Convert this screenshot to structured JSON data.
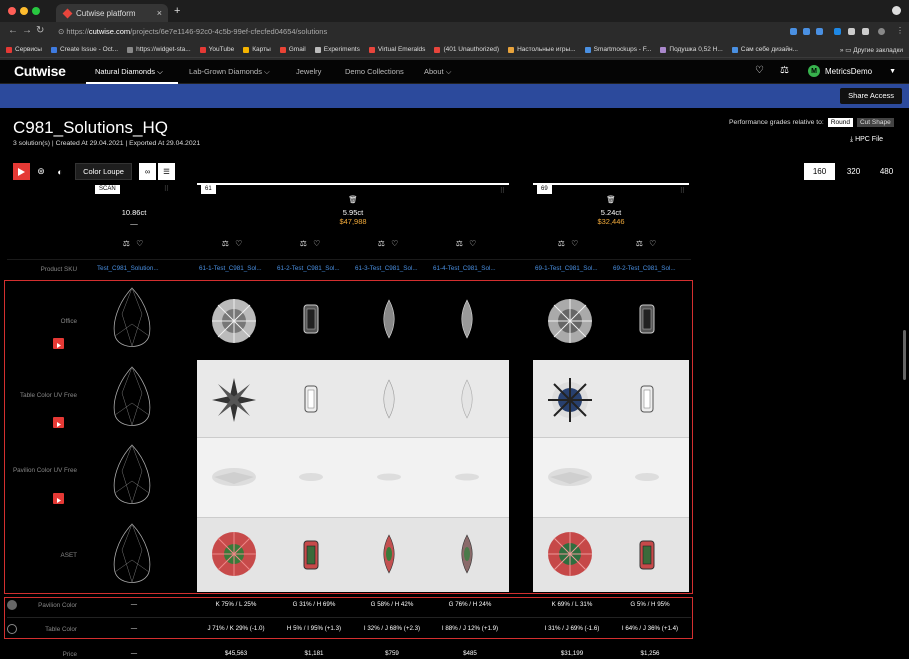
{
  "browser": {
    "tab_title": "Cutwise platform",
    "url_prefix": "https://",
    "url_domain": "cutwise.com",
    "url_path": "/projects/6e7e1146-92c0-4c5b-99ef-cfecfed04654/solutions",
    "bookmarks": [
      {
        "label": "Сервисы",
        "color": "#3f7be0"
      },
      {
        "label": "Create Issue - Oct...",
        "color": "#3f7be0"
      },
      {
        "label": "https://widget-sta...",
        "color": "#888"
      },
      {
        "label": "YouTube",
        "color": "#e53935"
      },
      {
        "label": "Карты",
        "color": "#f5b400"
      },
      {
        "label": "Gmail",
        "color": "#ea4335"
      },
      {
        "label": "Experiments",
        "color": "#bbb"
      },
      {
        "label": "Virtual Emeralds",
        "color": "#e8453c"
      },
      {
        "label": "(401 Unauthorized)",
        "color": "#e8453c"
      },
      {
        "label": "Настольные игры...",
        "color": "#e8a33c"
      },
      {
        "label": "Smartmockups - F...",
        "color": "#4a90e2"
      },
      {
        "label": "Подушка 0,52 Н...",
        "color": "#a8c"
      },
      {
        "label": "Сам себе дизайн...",
        "color": "#4a90e2"
      }
    ],
    "bookmarks_other": "Другие закладки"
  },
  "app": {
    "logo": "Cutwise",
    "nav": [
      "Natural Diamonds",
      "Lab-Grown Diamonds",
      "Jewelry",
      "Demo Collections",
      "About"
    ],
    "user_initial": "M",
    "user_name": "MetricsDemo",
    "share_label": "Share Access"
  },
  "project": {
    "title": "C981_Solutions_HQ",
    "meta": "3 solution(s) | Created At 29.04.2021 | Exported At 29.04.2021",
    "perf_label": "Performance grades relative to:",
    "perf_round": "Round",
    "perf_cut": "Cut Shape",
    "hpc_label": "HPC File"
  },
  "toolbar": {
    "color_loupe": "Color Loupe",
    "sizes": [
      "160",
      "320",
      "480"
    ],
    "active_size": "160"
  },
  "cards": [
    {
      "tag": "SCAN",
      "weight": "10.86ct",
      "price": "—"
    },
    {
      "tag": "61",
      "weight": "5.95ct",
      "price": "$47,988"
    },
    {
      "tag": "69",
      "weight": "5.24ct",
      "price": "$32,446"
    }
  ],
  "skus": [
    "Test_C981_Solution...",
    "61-1-Test_C981_Sol...",
    "61-2-Test_C981_Sol...",
    "61-3-Test_C981_Sol...",
    "61-4-Test_C981_Sol...",
    "69-1-Test_C981_Sol...",
    "69-2-Test_C981_Sol..."
  ],
  "row_labels": {
    "sku": "Product SKU",
    "office": "Office",
    "table_uv": "Table Color UV Free",
    "pavilion_uv": "Pavilion Color UV Free",
    "aset": "ASET",
    "pavilion_color": "Pavilion Color",
    "table_color": "Table Color",
    "price": "Price"
  },
  "pavilion_color": [
    "—",
    "K 75% / L 25%",
    "G 31% / H 69%",
    "G 58% / H 42%",
    "G 76% / H 24%",
    "K 69% / L 31%",
    "G 5% / H 95%"
  ],
  "table_color": [
    "—",
    "J 71% / K 29% (-1.0)",
    "H 5% / I 95% (+1.3)",
    "I 32% / J 68% (+2.3)",
    "I 88% / J 12% (+1.9)",
    "I 31% / J 69% (-1.6)",
    "I 64% / J 36% (+1.4)"
  ],
  "prices": [
    "—",
    "$45,563",
    "$1,181",
    "$759",
    "$485",
    "$31,199",
    "$1,256"
  ],
  "colors": {
    "accent_blue": "#2c4a9c",
    "red": "#e53935",
    "price_orange": "#f0a93a",
    "link_blue": "#4a90e2"
  }
}
